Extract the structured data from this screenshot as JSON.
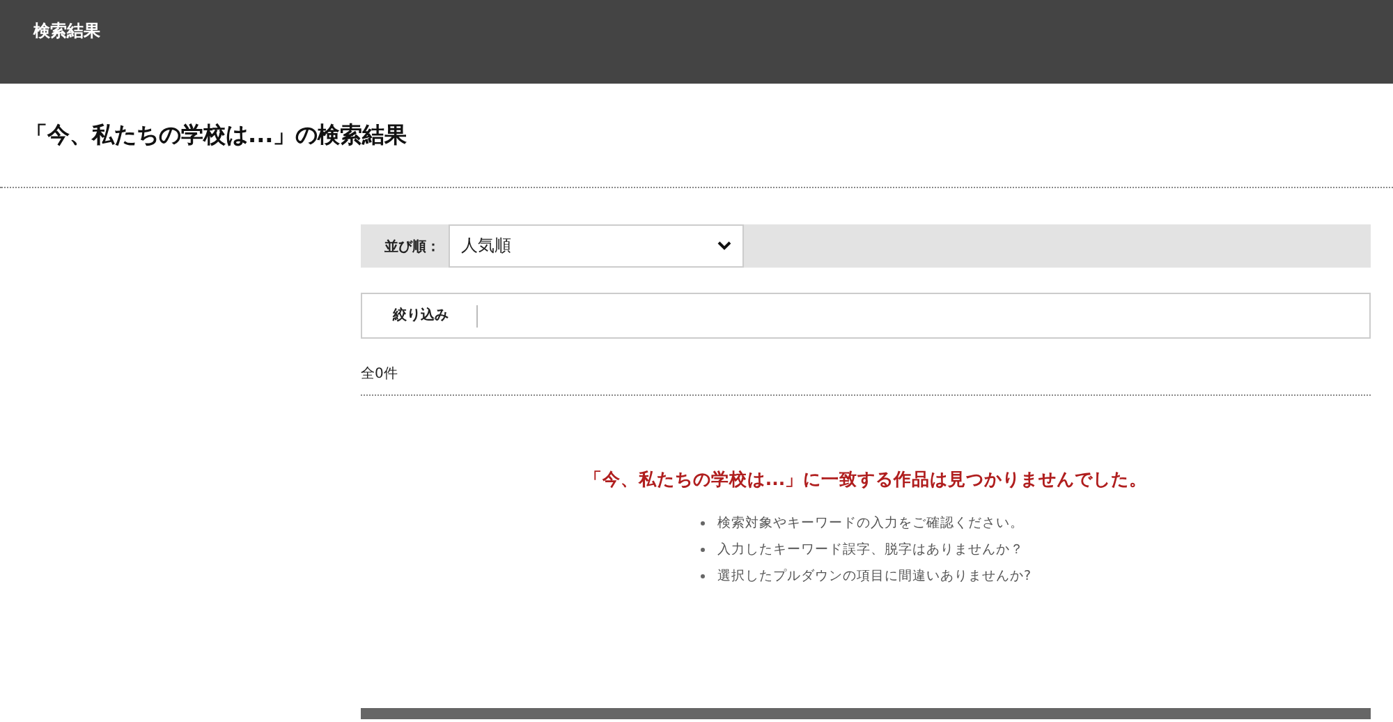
{
  "header": {
    "title": "検索結果"
  },
  "page_title": "「今、私たちの学校は...」の検索結果",
  "sort": {
    "label": "並び順：",
    "value": "人気順"
  },
  "filter": {
    "label": "絞り込み"
  },
  "count": "全0件",
  "no_results": {
    "message": "「今、私たちの学校は...」に一致する作品は見つかりませんでした。",
    "tips": [
      "検索対象やキーワードの入力をご確認ください。",
      "入力したキーワード誤字、脱字はありませんか？",
      "選択したプルダウンの項目に間違いありませんか?"
    ]
  }
}
